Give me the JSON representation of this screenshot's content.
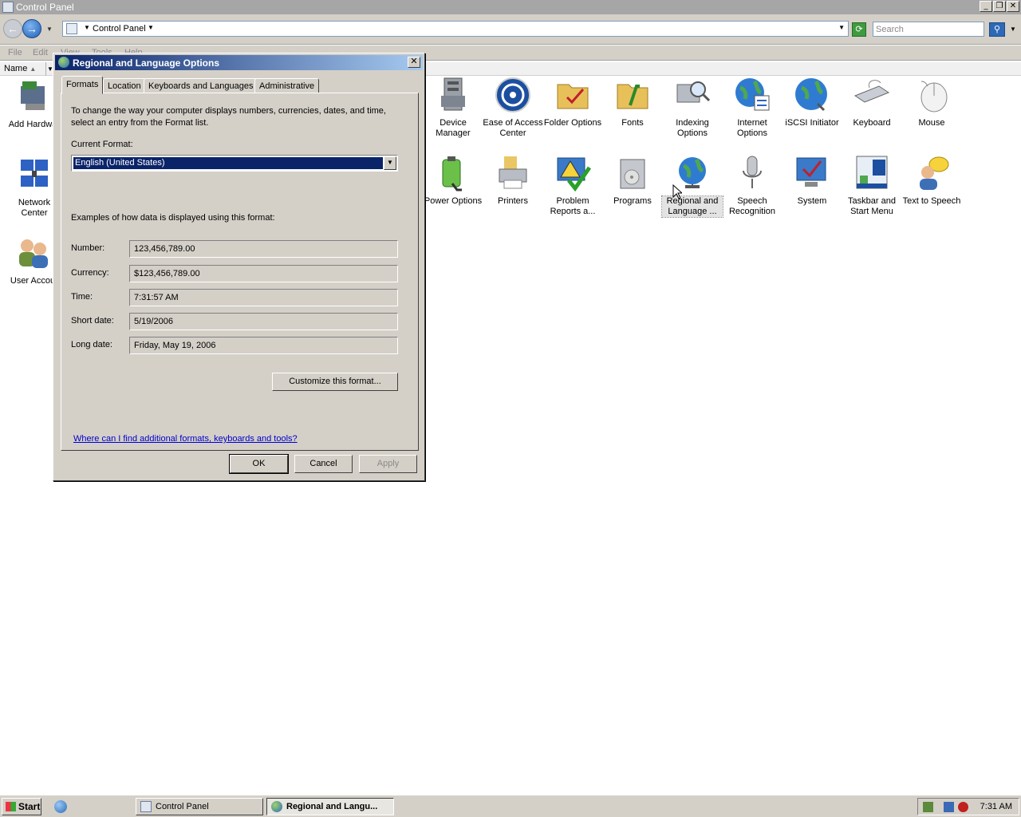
{
  "window": {
    "title": "Control Panel",
    "min_glyph": "_",
    "max_glyph": "❐",
    "close_glyph": "✕"
  },
  "address": {
    "location": "Control Panel",
    "search_placeholder": "Search"
  },
  "menu": [
    "File",
    "Edit",
    "View",
    "Tools",
    "Help"
  ],
  "column_header": "Name",
  "items": [
    {
      "label": "Add Hardwa",
      "icon": "add-hardware-icon"
    },
    {
      "label": "Network Center",
      "icon": "network-center-icon"
    },
    {
      "label": "User Accou",
      "icon": "user-accounts-icon"
    },
    {
      "label": "Device Manager",
      "icon": "device-manager-icon"
    },
    {
      "label": "Ease of Access Center",
      "icon": "ease-of-access-icon"
    },
    {
      "label": "Folder Options",
      "icon": "folder-options-icon"
    },
    {
      "label": "Fonts",
      "icon": "fonts-icon"
    },
    {
      "label": "Indexing Options",
      "icon": "indexing-options-icon"
    },
    {
      "label": "Internet Options",
      "icon": "internet-options-icon"
    },
    {
      "label": "iSCSI Initiator",
      "icon": "iscsi-initiator-icon"
    },
    {
      "label": "Keyboard",
      "icon": "keyboard-icon"
    },
    {
      "label": "Mouse",
      "icon": "mouse-icon"
    },
    {
      "label": "Power Options",
      "icon": "power-options-icon"
    },
    {
      "label": "Printers",
      "icon": "printers-icon"
    },
    {
      "label": "Problem Reports a...",
      "icon": "problem-reports-icon"
    },
    {
      "label": "Programs",
      "icon": "programs-icon"
    },
    {
      "label": "Regional and Language ...",
      "icon": "regional-language-icon"
    },
    {
      "label": "Speech Recognition",
      "icon": "speech-recognition-icon"
    },
    {
      "label": "System",
      "icon": "system-icon"
    },
    {
      "label": "Taskbar and Start Menu",
      "icon": "taskbar-start-menu-icon"
    },
    {
      "label": "Text to Speech",
      "icon": "text-to-speech-icon"
    }
  ],
  "dialog": {
    "title": "Regional and Language Options",
    "close_glyph": "✕",
    "tabs": [
      "Formats",
      "Location",
      "Keyboards and Languages",
      "Administrative"
    ],
    "intro": "To change the way your computer displays numbers, currencies, dates, and time, select an entry from the Format list.",
    "current_format_label": "Current Format:",
    "current_format_value": "English (United States)",
    "examples_heading": "Examples of how data is displayed using this format:",
    "examples": [
      {
        "label": "Number:",
        "value": "123,456,789.00"
      },
      {
        "label": "Currency:",
        "value": "$123,456,789.00"
      },
      {
        "label": "Time:",
        "value": "7:31:57 AM"
      },
      {
        "label": "Short date:",
        "value": "5/19/2006"
      },
      {
        "label": "Long date:",
        "value": "Friday, May 19, 2006"
      }
    ],
    "customize_button": "Customize this format...",
    "help_link": "Where can I find additional formats, keyboards and tools?",
    "ok": "OK",
    "cancel": "Cancel",
    "apply": "Apply"
  },
  "taskbar": {
    "start": "Start",
    "buttons": [
      "Control Panel",
      "Regional and Langu..."
    ],
    "clock": "7:31 AM"
  }
}
